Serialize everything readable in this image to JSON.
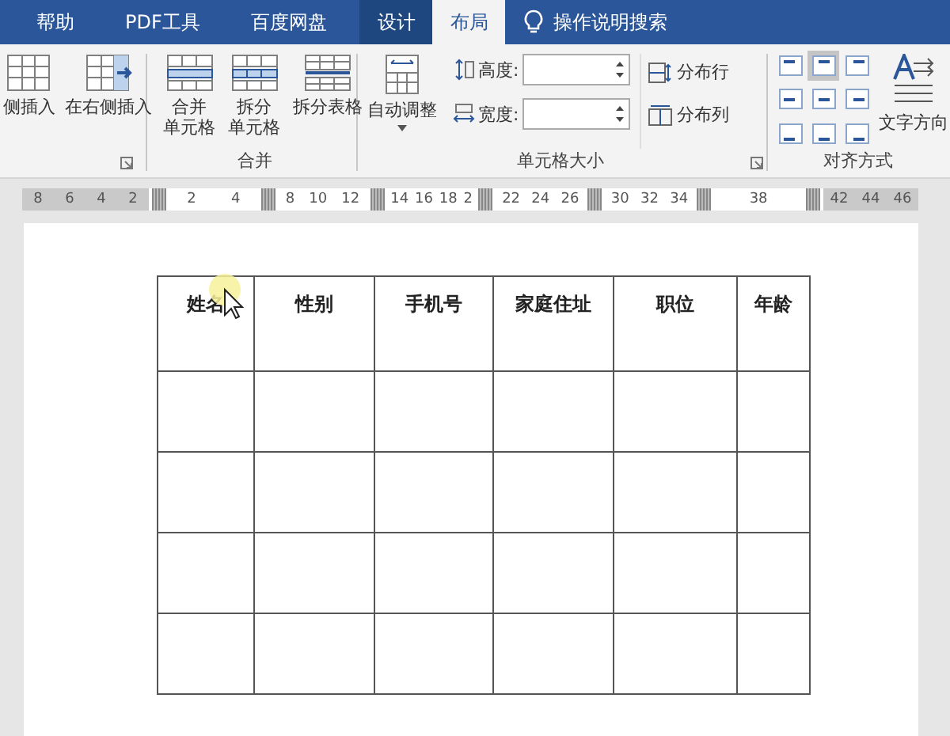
{
  "tabs": [
    {
      "label": "帮助",
      "selected": false,
      "kind": "plain"
    },
    {
      "label": "PDF工具",
      "selected": false,
      "kind": "plain"
    },
    {
      "label": "百度网盘",
      "selected": false,
      "kind": "plain"
    },
    {
      "label": "设计",
      "selected": false,
      "kind": "context"
    },
    {
      "label": "布局",
      "selected": true,
      "kind": "context"
    }
  ],
  "tell_me": {
    "label": "操作说明搜索"
  },
  "ribbon": {
    "groups": [
      {
        "kind": "insert",
        "buttons": [
          {
            "lines": [
              "侧插入"
            ],
            "kind": "insert-left"
          },
          {
            "lines": [
              "在右侧插入"
            ],
            "kind": "insert-right"
          }
        ],
        "launcher": true
      },
      {
        "kind": "merge",
        "label": "合并",
        "buttons": [
          {
            "lines": [
              "合并",
              "单元格"
            ],
            "kind": "merge"
          },
          {
            "lines": [
              "拆分",
              "单元格"
            ],
            "kind": "split"
          },
          {
            "lines": [
              "拆分表格"
            ],
            "kind": "split-table"
          }
        ]
      },
      {
        "kind": "size",
        "label": "单元格大小",
        "autofit": {
          "label": "自动调整"
        },
        "height": {
          "label": "高度:"
        },
        "width": {
          "label": "宽度:"
        },
        "distribute": [
          {
            "label": "分布行",
            "kind": "rows"
          },
          {
            "label": "分布列",
            "kind": "cols"
          }
        ],
        "launcher": true
      },
      {
        "kind": "align",
        "label": "对齐方式",
        "aligns": [
          {
            "selected": false
          },
          {
            "selected": true
          },
          {
            "selected": false
          },
          {
            "selected": false
          },
          {
            "selected": false
          },
          {
            "selected": false
          },
          {
            "selected": false
          },
          {
            "selected": false
          },
          {
            "selected": false
          }
        ],
        "direction": {
          "label": "文字方向"
        }
      }
    ]
  },
  "ruler": [
    {
      "kind": "margin",
      "labels": [
        "8",
        "6",
        "4",
        "2"
      ]
    },
    {
      "kind": "marker"
    },
    {
      "kind": "cell",
      "labels": [
        "2",
        "4"
      ]
    },
    {
      "kind": "marker"
    },
    {
      "kind": "cell",
      "labels": [
        "8",
        "10",
        "12"
      ]
    },
    {
      "kind": "marker"
    },
    {
      "kind": "cell",
      "labels": [
        "14",
        "16",
        "18",
        "2"
      ]
    },
    {
      "kind": "marker"
    },
    {
      "kind": "cell",
      "labels": [
        "22",
        "24",
        "26"
      ]
    },
    {
      "kind": "marker"
    },
    {
      "kind": "cell",
      "labels": [
        "30",
        "32",
        "34"
      ]
    },
    {
      "kind": "marker"
    },
    {
      "kind": "cell",
      "labels": [
        "38"
      ]
    },
    {
      "kind": "marker"
    },
    {
      "kind": "margin",
      "labels": [
        "42",
        "44",
        "46"
      ]
    }
  ],
  "table": {
    "columns": [
      "姓名",
      "性别",
      "手机号",
      "家庭住址",
      "职位",
      "年龄"
    ],
    "rows": [
      {
        "kind": "empty"
      },
      {
        "kind": "empty"
      },
      {
        "kind": "empty"
      },
      {
        "kind": "empty"
      }
    ]
  }
}
